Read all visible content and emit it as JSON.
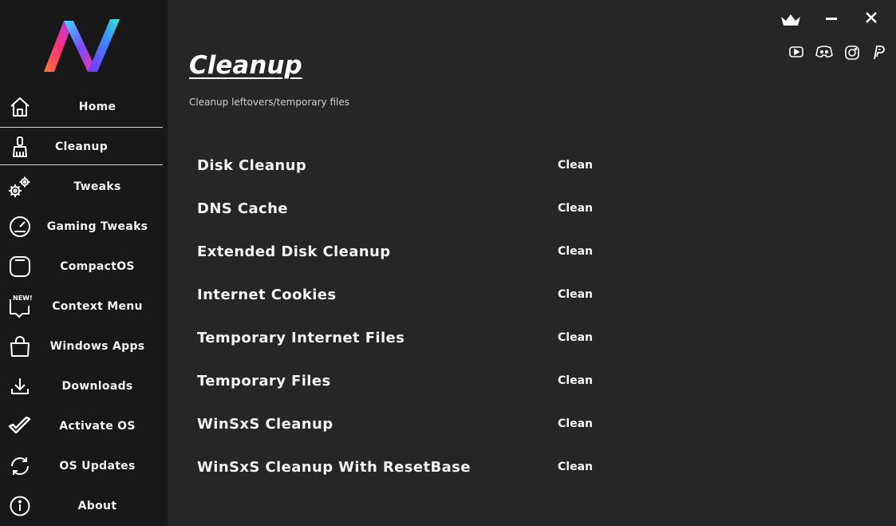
{
  "sidebar": {
    "items": [
      {
        "label": "Home",
        "icon": "home-icon"
      },
      {
        "label": "Cleanup",
        "icon": "broom-icon",
        "active": true
      },
      {
        "label": "Tweaks",
        "icon": "gears-icon"
      },
      {
        "label": "Gaming Tweaks",
        "icon": "speedometer-icon"
      },
      {
        "label": "CompactOS",
        "icon": "compact-icon"
      },
      {
        "label": "Context Menu",
        "icon": "new-badge-icon"
      },
      {
        "label": "Windows Apps",
        "icon": "bag-icon"
      },
      {
        "label": "Downloads",
        "icon": "download-icon"
      },
      {
        "label": "Activate OS",
        "icon": "checkmark-icon"
      },
      {
        "label": "OS Updates",
        "icon": "refresh-icon"
      },
      {
        "label": "About",
        "icon": "info-icon"
      }
    ],
    "new_badge": "NEW!"
  },
  "main": {
    "title": "Cleanup",
    "subtitle": "Cleanup leftovers/temporary files",
    "rows": [
      {
        "label": "Disk Cleanup",
        "action": "Clean"
      },
      {
        "label": "DNS Cache",
        "action": "Clean"
      },
      {
        "label": "Extended Disk Cleanup",
        "action": "Clean"
      },
      {
        "label": "Internet Cookies",
        "action": "Clean"
      },
      {
        "label": "Temporary Internet Files",
        "action": "Clean"
      },
      {
        "label": "Temporary Files",
        "action": "Clean"
      },
      {
        "label": "WinSxS Cleanup",
        "action": "Clean"
      },
      {
        "label": "WinSxS Cleanup With ResetBase",
        "action": "Clean"
      }
    ]
  },
  "colors": {
    "sidebar_bg": "#181818",
    "main_bg": "#262626",
    "text": "#ffffff"
  }
}
